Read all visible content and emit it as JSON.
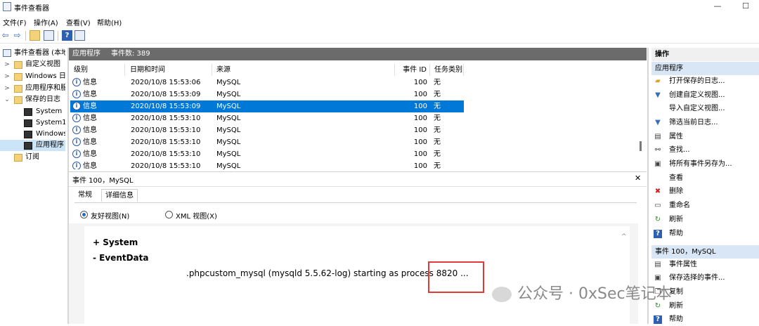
{
  "window": {
    "title": "事件查看器",
    "minimize": "—",
    "maximize": "☐"
  },
  "menu": [
    "文件(F)",
    "操作(A)",
    "查看(V)",
    "帮助(H)"
  ],
  "toolbar": {
    "back": "⇦",
    "forward": "⇨"
  },
  "tree": {
    "root": "事件查看器 (本地",
    "items": [
      {
        "label": "自定义视图",
        "arrow": ">"
      },
      {
        "label": "Windows 日",
        "arrow": ">"
      },
      {
        "label": "应用程序和服",
        "arrow": ">"
      },
      {
        "label": "保存的日志",
        "arrow": "⌄"
      },
      {
        "label": "System"
      },
      {
        "label": "System1"
      },
      {
        "label": "Windows"
      },
      {
        "label": "应用程序",
        "selected": true
      },
      {
        "label": "订阅"
      }
    ]
  },
  "log_header": {
    "name": "应用程序",
    "count": "事件数: 389"
  },
  "grid": {
    "columns": [
      "级别",
      "日期和时间",
      "来源",
      "事件 ID",
      "任务类别"
    ],
    "rows": [
      {
        "level": "信息",
        "datetime": "2020/10/8 15:53:06",
        "source": "MySQL",
        "event_id": "100",
        "category": "无",
        "selected": false
      },
      {
        "level": "信息",
        "datetime": "2020/10/8 15:53:09",
        "source": "MySQL",
        "event_id": "100",
        "category": "无",
        "selected": false
      },
      {
        "level": "信息",
        "datetime": "2020/10/8 15:53:09",
        "source": "MySQL",
        "event_id": "100",
        "category": "无",
        "selected": true
      },
      {
        "level": "信息",
        "datetime": "2020/10/8 15:53:10",
        "source": "MySQL",
        "event_id": "100",
        "category": "无",
        "selected": false
      },
      {
        "level": "信息",
        "datetime": "2020/10/8 15:53:10",
        "source": "MySQL",
        "event_id": "100",
        "category": "无",
        "selected": false
      },
      {
        "level": "信息",
        "datetime": "2020/10/8 15:53:10",
        "source": "MySQL",
        "event_id": "100",
        "category": "无",
        "selected": false
      },
      {
        "level": "信息",
        "datetime": "2020/10/8 15:53:10",
        "source": "MySQL",
        "event_id": "100",
        "category": "无",
        "selected": false
      },
      {
        "level": "信息",
        "datetime": "2020/10/8 15:53:10",
        "source": "MySQL",
        "event_id": "100",
        "category": "无",
        "selected": false
      }
    ]
  },
  "event_panel": {
    "title": "事件 100，MySQL",
    "close": "✕",
    "tabs": [
      "常规",
      "详细信息"
    ],
    "views": {
      "friendly": "友好视图(N)",
      "xml": "XML 视图(X)"
    },
    "system_label": "+  System",
    "eventdata_label": "-   EventData",
    "message": ".phpcustom_mysql (mysqld 5.5.62-log) starting as process 8820 ..."
  },
  "actions": {
    "header": "操作",
    "section1": "应用程序",
    "items1": [
      {
        "label": "打开保存的日志...",
        "icon": "folder-open-icon"
      },
      {
        "label": "创建自定义视图...",
        "icon": "filter-icon"
      },
      {
        "label": "导入自定义视图...",
        "icon": ""
      },
      {
        "label": "筛选当前日志...",
        "icon": "filter-icon"
      },
      {
        "label": "属性",
        "icon": "properties-icon"
      },
      {
        "label": "查找...",
        "icon": "find-icon"
      },
      {
        "label": "将所有事件另存为...",
        "icon": "save-icon"
      },
      {
        "label": "查看",
        "icon": ""
      },
      {
        "label": "删除",
        "icon": "delete-icon"
      },
      {
        "label": "重命名",
        "icon": "rename-icon"
      },
      {
        "label": "刷新",
        "icon": "refresh-icon"
      },
      {
        "label": "帮助",
        "icon": "help-icon"
      }
    ],
    "section2": "事件 100，MySQL",
    "items2": [
      {
        "label": "事件属性",
        "icon": "properties-icon"
      },
      {
        "label": "保存选择的事件...",
        "icon": "save-icon"
      },
      {
        "label": "复制",
        "icon": "copy-icon"
      },
      {
        "label": "刷新",
        "icon": "refresh-icon"
      },
      {
        "label": "帮助",
        "icon": "help-icon"
      }
    ]
  },
  "watermark": "公众号 · 0xSec笔记本",
  "colors": {
    "selection": "#0078d7",
    "header_bar": "#6b6b6b",
    "highlight_box": "#e03a3a"
  }
}
